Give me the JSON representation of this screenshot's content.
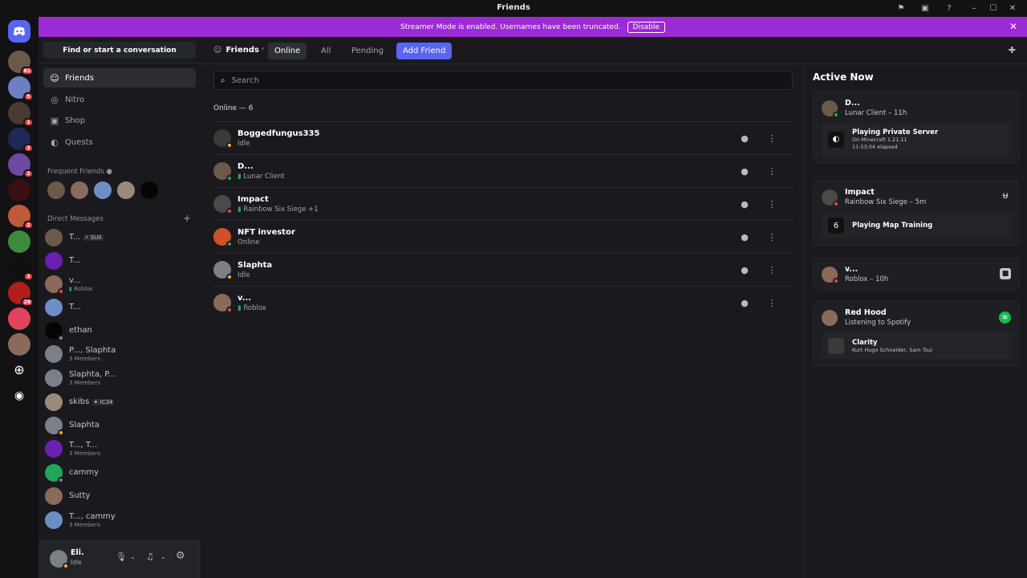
{
  "window": {
    "title": "Friends"
  },
  "banner": {
    "text": "Streamer Mode is enabled. Usernames have been truncated.",
    "disable_label": "Disable"
  },
  "guilds": {
    "badges": [
      "61",
      "5",
      "1",
      "2",
      "2",
      "",
      "",
      "2",
      "",
      "3",
      "28",
      "",
      ""
    ]
  },
  "sidebar": {
    "search_label": "Find or start a conversation",
    "nav": [
      {
        "label": "Friends",
        "icon": "people-icon"
      },
      {
        "label": "Nitro",
        "icon": "nitro-icon"
      },
      {
        "label": "Shop",
        "icon": "shop-icon"
      },
      {
        "label": "Quests",
        "icon": "quests-icon"
      }
    ],
    "frequent_friends_label": "Frequent Friends",
    "direct_messages_label": "Direct Messages",
    "dms": [
      {
        "name": "T...",
        "sub": "",
        "tag": "⚡ SUII"
      },
      {
        "name": "T...",
        "sub": "",
        "tag": ""
      },
      {
        "name": "v...",
        "sub": "Roblox",
        "tag": ""
      },
      {
        "name": "T...",
        "sub": "",
        "tag": ""
      },
      {
        "name": "ethan",
        "sub": "",
        "tag": ""
      },
      {
        "name": "P..., Slaphta",
        "sub": "3 Members",
        "tag": ""
      },
      {
        "name": "Slaphta, P...",
        "sub": "3 Members",
        "tag": ""
      },
      {
        "name": "skibs",
        "sub": "",
        "tag": "✦ IC34"
      },
      {
        "name": "Slaphta",
        "sub": "",
        "tag": ""
      },
      {
        "name": "T..., T...",
        "sub": "3 Members",
        "tag": ""
      },
      {
        "name": "cammy",
        "sub": "",
        "tag": ""
      },
      {
        "name": "Sutty",
        "sub": "",
        "tag": ""
      },
      {
        "name": "T..., cammy",
        "sub": "3 Members",
        "tag": ""
      }
    ],
    "user": {
      "name": "Eli.",
      "status": "Idle"
    }
  },
  "header": {
    "title": "Friends",
    "tabs": [
      "Online",
      "All",
      "Pending"
    ],
    "add_friend_label": "Add Friend"
  },
  "friends": {
    "search_placeholder": "Search",
    "online_heading": "Online — 6",
    "rows": [
      {
        "name": "Boggedfungus335",
        "status": "Idle",
        "activity": ""
      },
      {
        "name": "D...",
        "status": "",
        "activity": "Lunar Client"
      },
      {
        "name": "Impact",
        "status": "",
        "activity": "Rainbow Six Siege +1"
      },
      {
        "name": "NFT investor",
        "status": "Online",
        "activity": ""
      },
      {
        "name": "Slaphta",
        "status": "Idle",
        "activity": ""
      },
      {
        "name": "v...",
        "status": "",
        "activity": "Roblox"
      }
    ]
  },
  "active_now": {
    "title": "Active Now",
    "cards": [
      {
        "name": "D...",
        "sub": "Lunar Client – 11h",
        "inner_title": "Playing Private Server",
        "inner_line1": "On Minecraft 1.21.11",
        "inner_line2": "11:53:04 elapsed"
      },
      {
        "name": "Impact",
        "sub": "Rainbow Six Siege – 5m",
        "inner_title": "Playing Map Training",
        "inner_line1": "",
        "inner_line2": ""
      },
      {
        "name": "v...",
        "sub": "Roblox – 10h"
      },
      {
        "name": "Red Hood",
        "sub": "Listening to Spotify",
        "inner_title": "Clarity",
        "inner_line1": "Kurt Hugo Schneider, Sam Tsui",
        "inner_line2": ""
      }
    ]
  },
  "colors": {
    "accent": "#5865f2",
    "banner": "#9b2bd6",
    "online": "#23a55a",
    "dnd": "#f23f43",
    "idle": "#f0b232",
    "spotify": "#1db954"
  }
}
